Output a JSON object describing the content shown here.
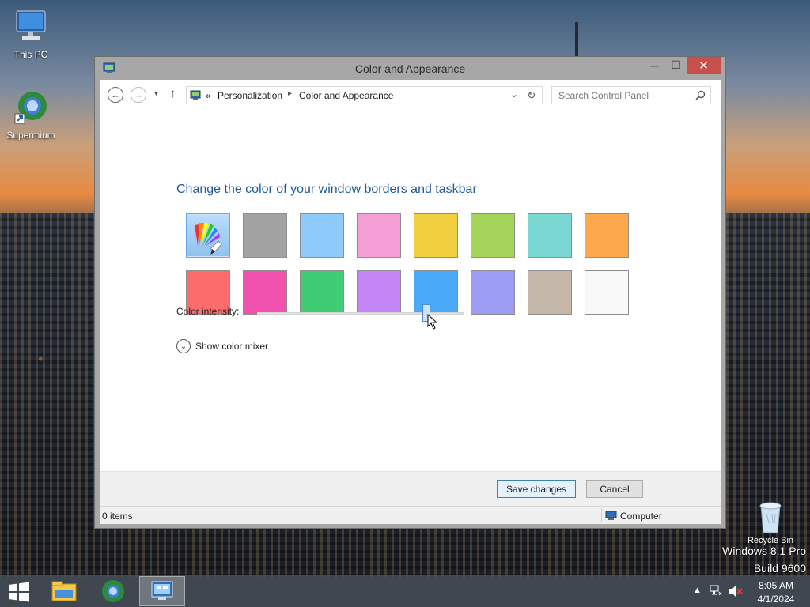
{
  "desktop": {
    "icons": [
      {
        "label": "This PC"
      },
      {
        "label": "Supermium"
      },
      {
        "label": "Recycle Bin"
      }
    ],
    "watermark": {
      "line1": "Windows 8.1 Pro",
      "line2": "Build 9600"
    }
  },
  "window": {
    "title": "Color and Appearance",
    "controls": {
      "minimize": "─",
      "maximize": "☐",
      "close": "✕"
    },
    "address": {
      "prefix": "«",
      "crumbs": [
        "Personalization",
        "Color and Appearance"
      ]
    },
    "search": {
      "placeholder": "Search Control Panel"
    },
    "heading": "Change the color of your window borders and taskbar",
    "swatches": {
      "row1": [
        {
          "name": "automatic",
          "color": "#8fc2f0",
          "selected": true
        },
        {
          "name": "gray",
          "color": "#a3a3a3"
        },
        {
          "name": "light-blue",
          "color": "#8fcbfa"
        },
        {
          "name": "pink",
          "color": "#f59fd6"
        },
        {
          "name": "yellow",
          "color": "#f2cf3e"
        },
        {
          "name": "lime",
          "color": "#a5d55a"
        },
        {
          "name": "teal",
          "color": "#7bd7d2"
        },
        {
          "name": "orange",
          "color": "#fea84e"
        }
      ],
      "row2": [
        {
          "name": "red",
          "color": "#fe6d6d"
        },
        {
          "name": "magenta",
          "color": "#f052ad"
        },
        {
          "name": "green",
          "color": "#3fcc74"
        },
        {
          "name": "violet",
          "color": "#c486f4"
        },
        {
          "name": "blue",
          "color": "#4aaaf8"
        },
        {
          "name": "periwinkle",
          "color": "#9c9cf5"
        },
        {
          "name": "taupe",
          "color": "#c5b7aa"
        },
        {
          "name": "white",
          "color": "#f9f9f9"
        }
      ]
    },
    "intensity": {
      "label": "Color intensity:",
      "value_fraction": 0.82
    },
    "mixer": {
      "label": "Show color mixer"
    },
    "buttons": {
      "save": "Save changes",
      "cancel": "Cancel"
    },
    "status": {
      "items": "0 items",
      "location": "Computer"
    }
  },
  "taskbar": {
    "clock": {
      "time": "8:05 AM",
      "date": "4/1/2024"
    },
    "tray": {
      "overflow": "▲"
    }
  }
}
